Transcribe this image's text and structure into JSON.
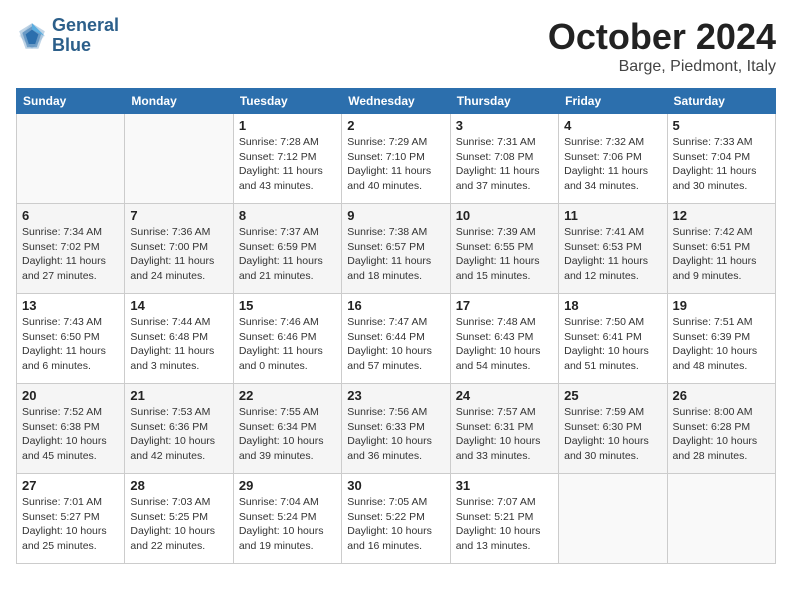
{
  "header": {
    "logo_line1": "General",
    "logo_line2": "Blue",
    "month": "October 2024",
    "location": "Barge, Piedmont, Italy"
  },
  "columns": [
    "Sunday",
    "Monday",
    "Tuesday",
    "Wednesday",
    "Thursday",
    "Friday",
    "Saturday"
  ],
  "weeks": [
    [
      {
        "day": "",
        "detail": ""
      },
      {
        "day": "",
        "detail": ""
      },
      {
        "day": "1",
        "detail": "Sunrise: 7:28 AM\nSunset: 7:12 PM\nDaylight: 11 hours and 43 minutes."
      },
      {
        "day": "2",
        "detail": "Sunrise: 7:29 AM\nSunset: 7:10 PM\nDaylight: 11 hours and 40 minutes."
      },
      {
        "day": "3",
        "detail": "Sunrise: 7:31 AM\nSunset: 7:08 PM\nDaylight: 11 hours and 37 minutes."
      },
      {
        "day": "4",
        "detail": "Sunrise: 7:32 AM\nSunset: 7:06 PM\nDaylight: 11 hours and 34 minutes."
      },
      {
        "day": "5",
        "detail": "Sunrise: 7:33 AM\nSunset: 7:04 PM\nDaylight: 11 hours and 30 minutes."
      }
    ],
    [
      {
        "day": "6",
        "detail": "Sunrise: 7:34 AM\nSunset: 7:02 PM\nDaylight: 11 hours and 27 minutes."
      },
      {
        "day": "7",
        "detail": "Sunrise: 7:36 AM\nSunset: 7:00 PM\nDaylight: 11 hours and 24 minutes."
      },
      {
        "day": "8",
        "detail": "Sunrise: 7:37 AM\nSunset: 6:59 PM\nDaylight: 11 hours and 21 minutes."
      },
      {
        "day": "9",
        "detail": "Sunrise: 7:38 AM\nSunset: 6:57 PM\nDaylight: 11 hours and 18 minutes."
      },
      {
        "day": "10",
        "detail": "Sunrise: 7:39 AM\nSunset: 6:55 PM\nDaylight: 11 hours and 15 minutes."
      },
      {
        "day": "11",
        "detail": "Sunrise: 7:41 AM\nSunset: 6:53 PM\nDaylight: 11 hours and 12 minutes."
      },
      {
        "day": "12",
        "detail": "Sunrise: 7:42 AM\nSunset: 6:51 PM\nDaylight: 11 hours and 9 minutes."
      }
    ],
    [
      {
        "day": "13",
        "detail": "Sunrise: 7:43 AM\nSunset: 6:50 PM\nDaylight: 11 hours and 6 minutes."
      },
      {
        "day": "14",
        "detail": "Sunrise: 7:44 AM\nSunset: 6:48 PM\nDaylight: 11 hours and 3 minutes."
      },
      {
        "day": "15",
        "detail": "Sunrise: 7:46 AM\nSunset: 6:46 PM\nDaylight: 11 hours and 0 minutes."
      },
      {
        "day": "16",
        "detail": "Sunrise: 7:47 AM\nSunset: 6:44 PM\nDaylight: 10 hours and 57 minutes."
      },
      {
        "day": "17",
        "detail": "Sunrise: 7:48 AM\nSunset: 6:43 PM\nDaylight: 10 hours and 54 minutes."
      },
      {
        "day": "18",
        "detail": "Sunrise: 7:50 AM\nSunset: 6:41 PM\nDaylight: 10 hours and 51 minutes."
      },
      {
        "day": "19",
        "detail": "Sunrise: 7:51 AM\nSunset: 6:39 PM\nDaylight: 10 hours and 48 minutes."
      }
    ],
    [
      {
        "day": "20",
        "detail": "Sunrise: 7:52 AM\nSunset: 6:38 PM\nDaylight: 10 hours and 45 minutes."
      },
      {
        "day": "21",
        "detail": "Sunrise: 7:53 AM\nSunset: 6:36 PM\nDaylight: 10 hours and 42 minutes."
      },
      {
        "day": "22",
        "detail": "Sunrise: 7:55 AM\nSunset: 6:34 PM\nDaylight: 10 hours and 39 minutes."
      },
      {
        "day": "23",
        "detail": "Sunrise: 7:56 AM\nSunset: 6:33 PM\nDaylight: 10 hours and 36 minutes."
      },
      {
        "day": "24",
        "detail": "Sunrise: 7:57 AM\nSunset: 6:31 PM\nDaylight: 10 hours and 33 minutes."
      },
      {
        "day": "25",
        "detail": "Sunrise: 7:59 AM\nSunset: 6:30 PM\nDaylight: 10 hours and 30 minutes."
      },
      {
        "day": "26",
        "detail": "Sunrise: 8:00 AM\nSunset: 6:28 PM\nDaylight: 10 hours and 28 minutes."
      }
    ],
    [
      {
        "day": "27",
        "detail": "Sunrise: 7:01 AM\nSunset: 5:27 PM\nDaylight: 10 hours and 25 minutes."
      },
      {
        "day": "28",
        "detail": "Sunrise: 7:03 AM\nSunset: 5:25 PM\nDaylight: 10 hours and 22 minutes."
      },
      {
        "day": "29",
        "detail": "Sunrise: 7:04 AM\nSunset: 5:24 PM\nDaylight: 10 hours and 19 minutes."
      },
      {
        "day": "30",
        "detail": "Sunrise: 7:05 AM\nSunset: 5:22 PM\nDaylight: 10 hours and 16 minutes."
      },
      {
        "day": "31",
        "detail": "Sunrise: 7:07 AM\nSunset: 5:21 PM\nDaylight: 10 hours and 13 minutes."
      },
      {
        "day": "",
        "detail": ""
      },
      {
        "day": "",
        "detail": ""
      }
    ]
  ]
}
